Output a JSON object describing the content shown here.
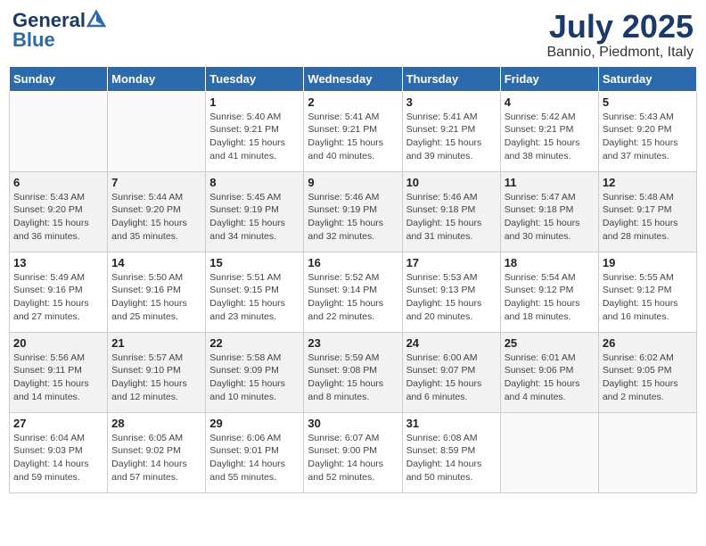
{
  "header": {
    "logo_general": "General",
    "logo_blue": "Blue",
    "month": "July 2025",
    "location": "Bannio, Piedmont, Italy"
  },
  "days_of_week": [
    "Sunday",
    "Monday",
    "Tuesday",
    "Wednesday",
    "Thursday",
    "Friday",
    "Saturday"
  ],
  "weeks": [
    [
      {
        "day": "",
        "info": ""
      },
      {
        "day": "",
        "info": ""
      },
      {
        "day": "1",
        "info": "Sunrise: 5:40 AM\nSunset: 9:21 PM\nDaylight: 15 hours\nand 41 minutes."
      },
      {
        "day": "2",
        "info": "Sunrise: 5:41 AM\nSunset: 9:21 PM\nDaylight: 15 hours\nand 40 minutes."
      },
      {
        "day": "3",
        "info": "Sunrise: 5:41 AM\nSunset: 9:21 PM\nDaylight: 15 hours\nand 39 minutes."
      },
      {
        "day": "4",
        "info": "Sunrise: 5:42 AM\nSunset: 9:21 PM\nDaylight: 15 hours\nand 38 minutes."
      },
      {
        "day": "5",
        "info": "Sunrise: 5:43 AM\nSunset: 9:20 PM\nDaylight: 15 hours\nand 37 minutes."
      }
    ],
    [
      {
        "day": "6",
        "info": "Sunrise: 5:43 AM\nSunset: 9:20 PM\nDaylight: 15 hours\nand 36 minutes."
      },
      {
        "day": "7",
        "info": "Sunrise: 5:44 AM\nSunset: 9:20 PM\nDaylight: 15 hours\nand 35 minutes."
      },
      {
        "day": "8",
        "info": "Sunrise: 5:45 AM\nSunset: 9:19 PM\nDaylight: 15 hours\nand 34 minutes."
      },
      {
        "day": "9",
        "info": "Sunrise: 5:46 AM\nSunset: 9:19 PM\nDaylight: 15 hours\nand 32 minutes."
      },
      {
        "day": "10",
        "info": "Sunrise: 5:46 AM\nSunset: 9:18 PM\nDaylight: 15 hours\nand 31 minutes."
      },
      {
        "day": "11",
        "info": "Sunrise: 5:47 AM\nSunset: 9:18 PM\nDaylight: 15 hours\nand 30 minutes."
      },
      {
        "day": "12",
        "info": "Sunrise: 5:48 AM\nSunset: 9:17 PM\nDaylight: 15 hours\nand 28 minutes."
      }
    ],
    [
      {
        "day": "13",
        "info": "Sunrise: 5:49 AM\nSunset: 9:16 PM\nDaylight: 15 hours\nand 27 minutes."
      },
      {
        "day": "14",
        "info": "Sunrise: 5:50 AM\nSunset: 9:16 PM\nDaylight: 15 hours\nand 25 minutes."
      },
      {
        "day": "15",
        "info": "Sunrise: 5:51 AM\nSunset: 9:15 PM\nDaylight: 15 hours\nand 23 minutes."
      },
      {
        "day": "16",
        "info": "Sunrise: 5:52 AM\nSunset: 9:14 PM\nDaylight: 15 hours\nand 22 minutes."
      },
      {
        "day": "17",
        "info": "Sunrise: 5:53 AM\nSunset: 9:13 PM\nDaylight: 15 hours\nand 20 minutes."
      },
      {
        "day": "18",
        "info": "Sunrise: 5:54 AM\nSunset: 9:12 PM\nDaylight: 15 hours\nand 18 minutes."
      },
      {
        "day": "19",
        "info": "Sunrise: 5:55 AM\nSunset: 9:12 PM\nDaylight: 15 hours\nand 16 minutes."
      }
    ],
    [
      {
        "day": "20",
        "info": "Sunrise: 5:56 AM\nSunset: 9:11 PM\nDaylight: 15 hours\nand 14 minutes."
      },
      {
        "day": "21",
        "info": "Sunrise: 5:57 AM\nSunset: 9:10 PM\nDaylight: 15 hours\nand 12 minutes."
      },
      {
        "day": "22",
        "info": "Sunrise: 5:58 AM\nSunset: 9:09 PM\nDaylight: 15 hours\nand 10 minutes."
      },
      {
        "day": "23",
        "info": "Sunrise: 5:59 AM\nSunset: 9:08 PM\nDaylight: 15 hours\nand 8 minutes."
      },
      {
        "day": "24",
        "info": "Sunrise: 6:00 AM\nSunset: 9:07 PM\nDaylight: 15 hours\nand 6 minutes."
      },
      {
        "day": "25",
        "info": "Sunrise: 6:01 AM\nSunset: 9:06 PM\nDaylight: 15 hours\nand 4 minutes."
      },
      {
        "day": "26",
        "info": "Sunrise: 6:02 AM\nSunset: 9:05 PM\nDaylight: 15 hours\nand 2 minutes."
      }
    ],
    [
      {
        "day": "27",
        "info": "Sunrise: 6:04 AM\nSunset: 9:03 PM\nDaylight: 14 hours\nand 59 minutes."
      },
      {
        "day": "28",
        "info": "Sunrise: 6:05 AM\nSunset: 9:02 PM\nDaylight: 14 hours\nand 57 minutes."
      },
      {
        "day": "29",
        "info": "Sunrise: 6:06 AM\nSunset: 9:01 PM\nDaylight: 14 hours\nand 55 minutes."
      },
      {
        "day": "30",
        "info": "Sunrise: 6:07 AM\nSunset: 9:00 PM\nDaylight: 14 hours\nand 52 minutes."
      },
      {
        "day": "31",
        "info": "Sunrise: 6:08 AM\nSunset: 8:59 PM\nDaylight: 14 hours\nand 50 minutes."
      },
      {
        "day": "",
        "info": ""
      },
      {
        "day": "",
        "info": ""
      }
    ]
  ]
}
